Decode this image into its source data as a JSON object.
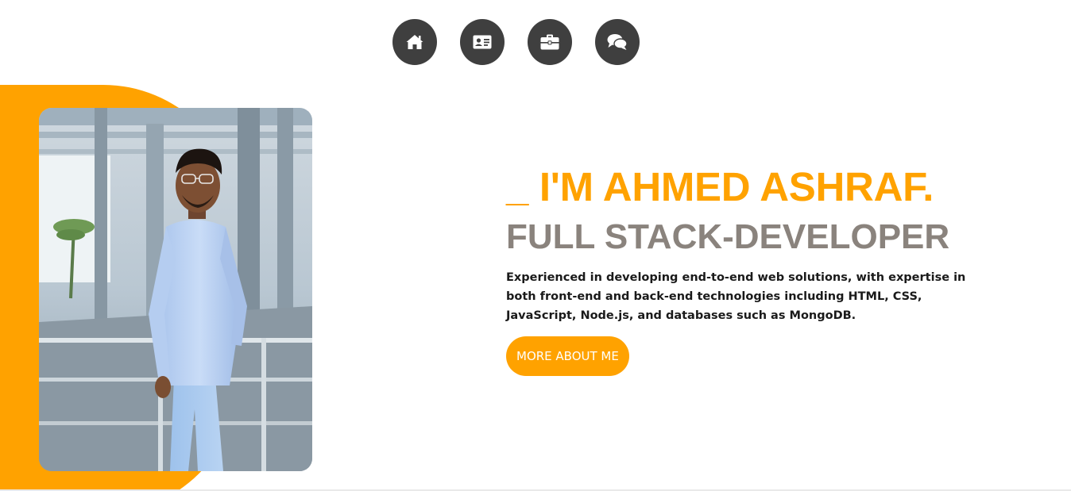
{
  "nav": {
    "items": [
      {
        "icon": "home-icon",
        "label": ""
      },
      {
        "icon": "id-card-icon",
        "label": ""
      },
      {
        "icon": "briefcase-icon",
        "label": ""
      },
      {
        "icon": "chat-bubbles-icon",
        "label": ""
      }
    ]
  },
  "hero": {
    "headline": "_ I'M AHMED ASHRAF.",
    "subheadline": "FULL STACK-DEVELOPER",
    "bio": "Experienced in developing end-to-end web solutions, with expertise in both front-end and back-end technologies including HTML, CSS, JavaScript, Node.js, and databases such as MongoDB.",
    "cta_label": "MORE ABOUT ME"
  },
  "colors": {
    "accent": "#FFA200",
    "nav_bg": "#3f3f3f",
    "subheadline": "#8a837d",
    "text": "#1a1a1a"
  }
}
